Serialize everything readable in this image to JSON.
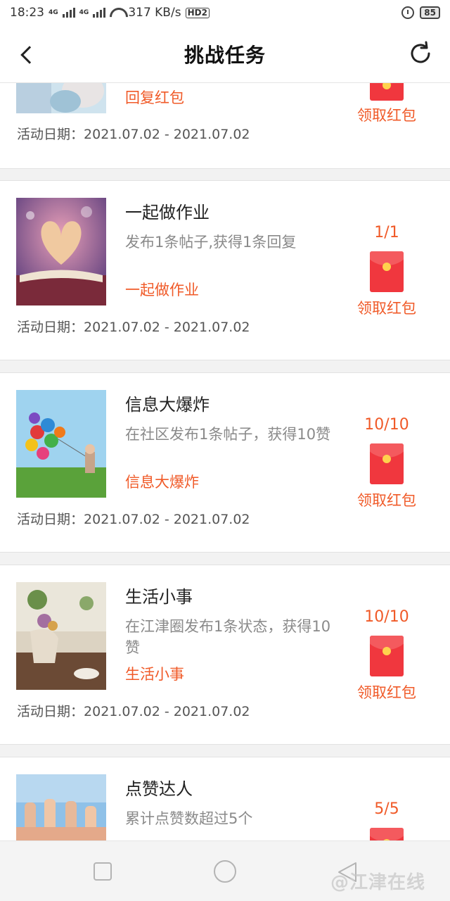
{
  "status_bar": {
    "time": "18:23",
    "network_label_1": "4G",
    "network_label_2": "4G",
    "speed": "317 KB/s",
    "hd": "HD2",
    "battery": "85"
  },
  "nav": {
    "title": "挑战任务",
    "back_icon": "chevron-left-icon",
    "refresh_icon": "refresh-icon"
  },
  "date_label": "活动日期：",
  "tasks": [
    {
      "title": "",
      "description": "",
      "tag": "回复红包",
      "progress": "",
      "claim_label": "领取红包",
      "date": "2021.07.02 - 2021.07.02"
    },
    {
      "title": "一起做作业",
      "description": "发布1条帖子,获得1条回复",
      "tag": "一起做作业",
      "progress": "1/1",
      "claim_label": "领取红包",
      "date": "2021.07.02 - 2021.07.02"
    },
    {
      "title": "信息大爆炸",
      "description": "在社区发布1条帖子，获得10赞",
      "tag": "信息大爆炸",
      "progress": "10/10",
      "claim_label": "领取红包",
      "date": "2021.07.02 - 2021.07.02"
    },
    {
      "title": "生活小事",
      "description": "在江津圈发布1条状态，获得10赞",
      "tag": "生活小事",
      "progress": "10/10",
      "claim_label": "领取红包",
      "date": "2021.07.02 - 2021.07.02"
    },
    {
      "title": "点赞达人",
      "description": "累计点赞数超过5个",
      "tag": "",
      "progress": "5/5",
      "claim_label": "",
      "date": ""
    }
  ],
  "system_nav": {
    "recent_icon": "square-icon",
    "home_icon": "circle-icon",
    "back_icon": "triangle-back-icon",
    "watermark": "@江津在线"
  },
  "colors": {
    "accent": "#f05a28",
    "envelope": "#f0373e"
  }
}
